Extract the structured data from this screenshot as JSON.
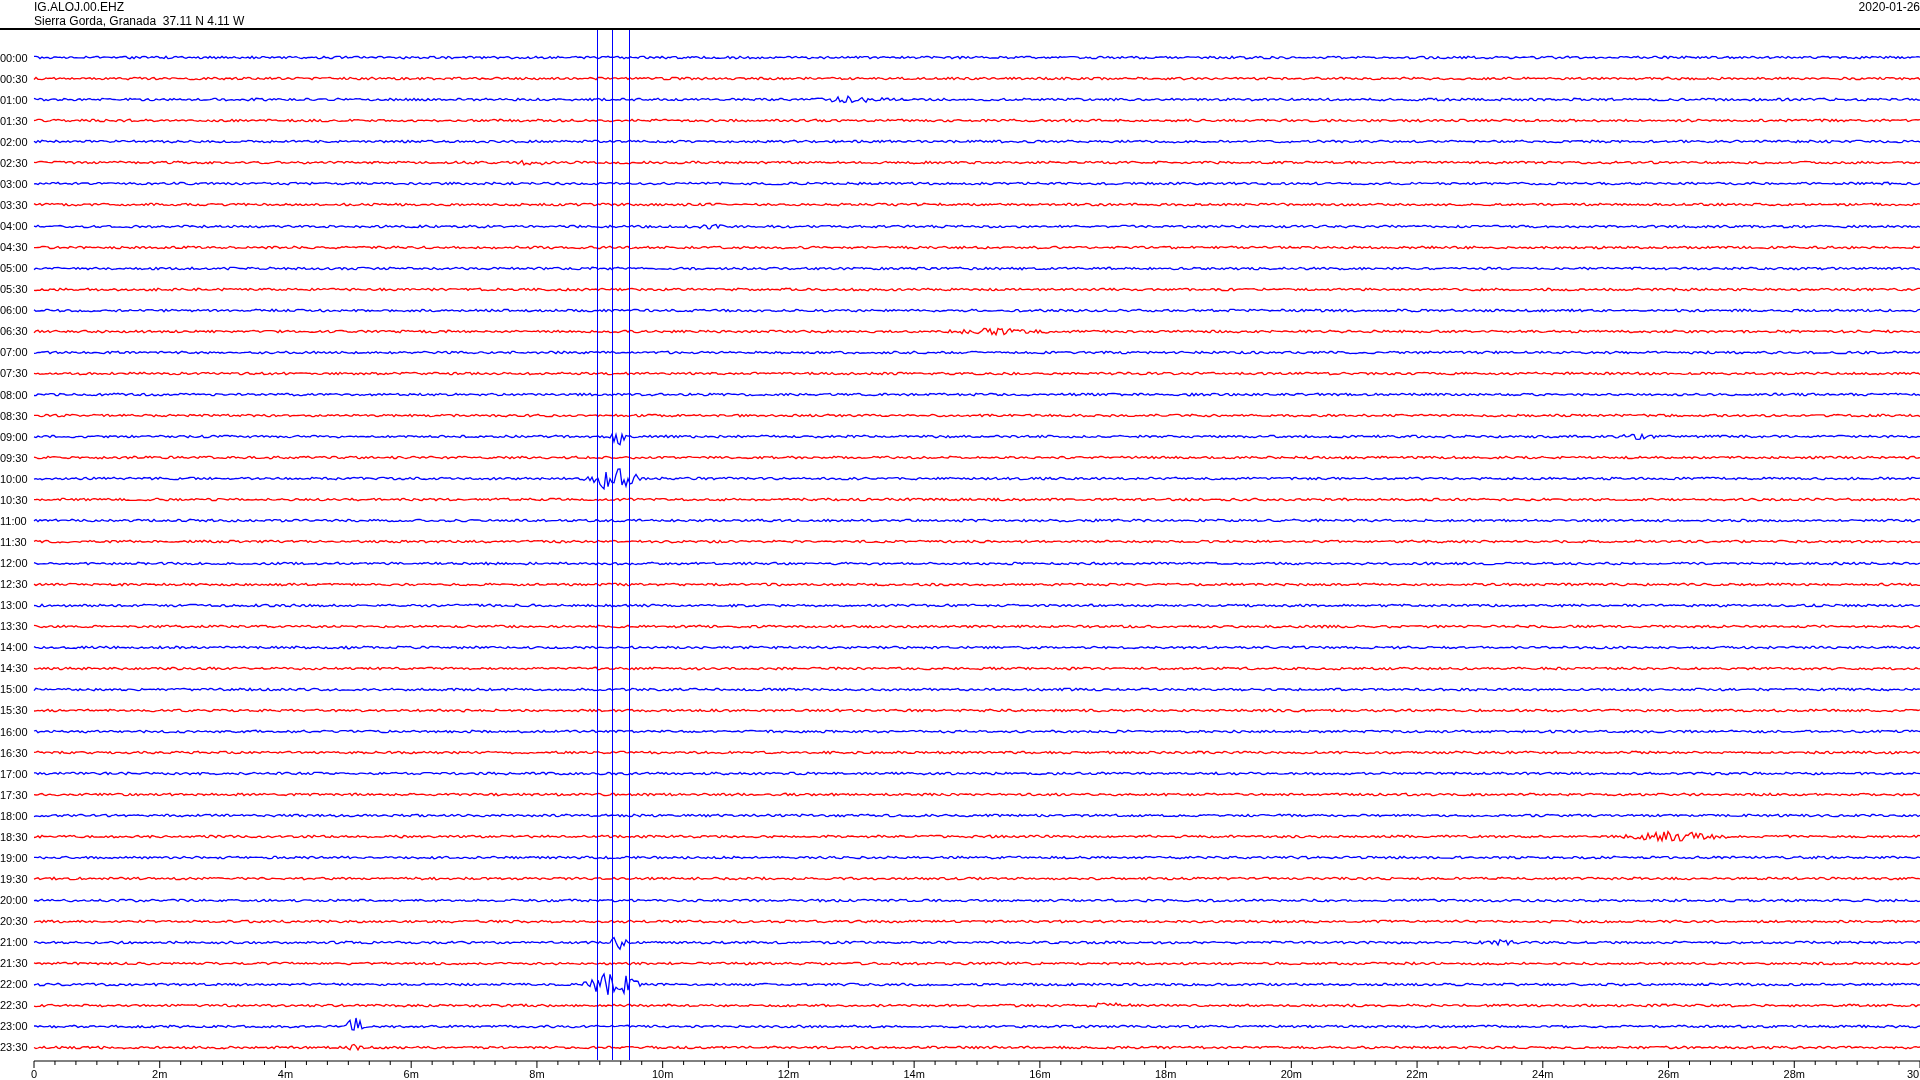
{
  "header": {
    "station": "IG.ALOJ.00.EHZ",
    "location": "Sierra Gorda, Granada  37.11 N 4.11 W",
    "date": "2020-01-26"
  },
  "rows": [
    {
      "label": "00:00",
      "color": "#0000ff"
    },
    {
      "label": "00:30",
      "color": "#ff0000"
    },
    {
      "label": "01:00",
      "color": "#0000ff"
    },
    {
      "label": "01:30",
      "color": "#ff0000"
    },
    {
      "label": "02:00",
      "color": "#0000ff"
    },
    {
      "label": "02:30",
      "color": "#ff0000"
    },
    {
      "label": "03:00",
      "color": "#0000ff"
    },
    {
      "label": "03:30",
      "color": "#ff0000"
    },
    {
      "label": "04:00",
      "color": "#0000ff"
    },
    {
      "label": "04:30",
      "color": "#ff0000"
    },
    {
      "label": "05:00",
      "color": "#0000ff"
    },
    {
      "label": "05:30",
      "color": "#ff0000"
    },
    {
      "label": "06:00",
      "color": "#0000ff"
    },
    {
      "label": "06:30",
      "color": "#ff0000"
    },
    {
      "label": "07:00",
      "color": "#0000ff"
    },
    {
      "label": "07:30",
      "color": "#ff0000"
    },
    {
      "label": "08:00",
      "color": "#0000ff"
    },
    {
      "label": "08:30",
      "color": "#ff0000"
    },
    {
      "label": "09:00",
      "color": "#0000ff"
    },
    {
      "label": "09:30",
      "color": "#ff0000"
    },
    {
      "label": "10:00",
      "color": "#0000ff"
    },
    {
      "label": "10:30",
      "color": "#ff0000"
    },
    {
      "label": "11:00",
      "color": "#0000ff"
    },
    {
      "label": "11:30",
      "color": "#ff0000"
    },
    {
      "label": "12:00",
      "color": "#0000ff"
    },
    {
      "label": "12:30",
      "color": "#ff0000"
    },
    {
      "label": "13:00",
      "color": "#0000ff"
    },
    {
      "label": "13:30",
      "color": "#ff0000"
    },
    {
      "label": "14:00",
      "color": "#0000ff"
    },
    {
      "label": "14:30",
      "color": "#ff0000"
    },
    {
      "label": "15:00",
      "color": "#0000ff"
    },
    {
      "label": "15:30",
      "color": "#ff0000"
    },
    {
      "label": "16:00",
      "color": "#0000ff"
    },
    {
      "label": "16:30",
      "color": "#ff0000"
    },
    {
      "label": "17:00",
      "color": "#0000ff"
    },
    {
      "label": "17:30",
      "color": "#ff0000"
    },
    {
      "label": "18:00",
      "color": "#0000ff"
    },
    {
      "label": "18:30",
      "color": "#ff0000"
    },
    {
      "label": "19:00",
      "color": "#0000ff"
    },
    {
      "label": "19:30",
      "color": "#ff0000"
    },
    {
      "label": "20:00",
      "color": "#0000ff"
    },
    {
      "label": "20:30",
      "color": "#ff0000"
    },
    {
      "label": "21:00",
      "color": "#0000ff"
    },
    {
      "label": "21:30",
      "color": "#ff0000"
    },
    {
      "label": "22:00",
      "color": "#0000ff"
    },
    {
      "label": "22:30",
      "color": "#ff0000"
    },
    {
      "label": "23:00",
      "color": "#0000ff"
    },
    {
      "label": "23:30",
      "color": "#ff0000"
    }
  ],
  "x_axis": {
    "ticks": [
      "0",
      "2m",
      "4m",
      "6m",
      "8m",
      "10m",
      "12m",
      "14m",
      "16m",
      "18m",
      "20m",
      "22m",
      "24m",
      "26m",
      "28m",
      "30"
    ]
  }
}
